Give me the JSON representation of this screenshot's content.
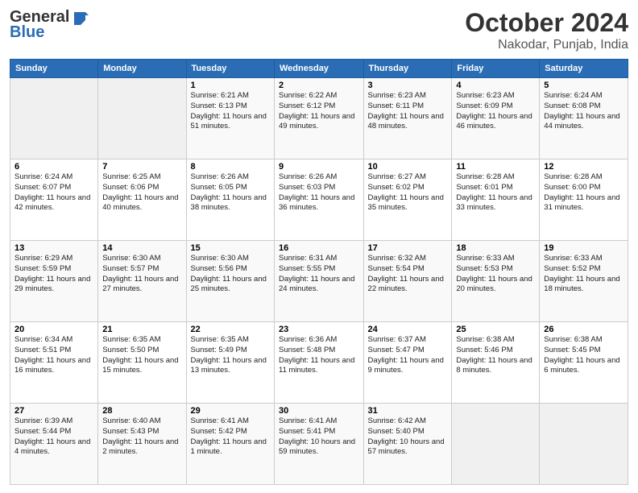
{
  "logo": {
    "general": "General",
    "blue": "Blue"
  },
  "title": "October 2024",
  "location": "Nakodar, Punjab, India",
  "days_of_week": [
    "Sunday",
    "Monday",
    "Tuesday",
    "Wednesday",
    "Thursday",
    "Friday",
    "Saturday"
  ],
  "weeks": [
    [
      {
        "day": "",
        "info": ""
      },
      {
        "day": "",
        "info": ""
      },
      {
        "day": "1",
        "info": "Sunrise: 6:21 AM\nSunset: 6:13 PM\nDaylight: 11 hours and 51 minutes."
      },
      {
        "day": "2",
        "info": "Sunrise: 6:22 AM\nSunset: 6:12 PM\nDaylight: 11 hours and 49 minutes."
      },
      {
        "day": "3",
        "info": "Sunrise: 6:23 AM\nSunset: 6:11 PM\nDaylight: 11 hours and 48 minutes."
      },
      {
        "day": "4",
        "info": "Sunrise: 6:23 AM\nSunset: 6:09 PM\nDaylight: 11 hours and 46 minutes."
      },
      {
        "day": "5",
        "info": "Sunrise: 6:24 AM\nSunset: 6:08 PM\nDaylight: 11 hours and 44 minutes."
      }
    ],
    [
      {
        "day": "6",
        "info": "Sunrise: 6:24 AM\nSunset: 6:07 PM\nDaylight: 11 hours and 42 minutes."
      },
      {
        "day": "7",
        "info": "Sunrise: 6:25 AM\nSunset: 6:06 PM\nDaylight: 11 hours and 40 minutes."
      },
      {
        "day": "8",
        "info": "Sunrise: 6:26 AM\nSunset: 6:05 PM\nDaylight: 11 hours and 38 minutes."
      },
      {
        "day": "9",
        "info": "Sunrise: 6:26 AM\nSunset: 6:03 PM\nDaylight: 11 hours and 36 minutes."
      },
      {
        "day": "10",
        "info": "Sunrise: 6:27 AM\nSunset: 6:02 PM\nDaylight: 11 hours and 35 minutes."
      },
      {
        "day": "11",
        "info": "Sunrise: 6:28 AM\nSunset: 6:01 PM\nDaylight: 11 hours and 33 minutes."
      },
      {
        "day": "12",
        "info": "Sunrise: 6:28 AM\nSunset: 6:00 PM\nDaylight: 11 hours and 31 minutes."
      }
    ],
    [
      {
        "day": "13",
        "info": "Sunrise: 6:29 AM\nSunset: 5:59 PM\nDaylight: 11 hours and 29 minutes."
      },
      {
        "day": "14",
        "info": "Sunrise: 6:30 AM\nSunset: 5:57 PM\nDaylight: 11 hours and 27 minutes."
      },
      {
        "day": "15",
        "info": "Sunrise: 6:30 AM\nSunset: 5:56 PM\nDaylight: 11 hours and 25 minutes."
      },
      {
        "day": "16",
        "info": "Sunrise: 6:31 AM\nSunset: 5:55 PM\nDaylight: 11 hours and 24 minutes."
      },
      {
        "day": "17",
        "info": "Sunrise: 6:32 AM\nSunset: 5:54 PM\nDaylight: 11 hours and 22 minutes."
      },
      {
        "day": "18",
        "info": "Sunrise: 6:33 AM\nSunset: 5:53 PM\nDaylight: 11 hours and 20 minutes."
      },
      {
        "day": "19",
        "info": "Sunrise: 6:33 AM\nSunset: 5:52 PM\nDaylight: 11 hours and 18 minutes."
      }
    ],
    [
      {
        "day": "20",
        "info": "Sunrise: 6:34 AM\nSunset: 5:51 PM\nDaylight: 11 hours and 16 minutes."
      },
      {
        "day": "21",
        "info": "Sunrise: 6:35 AM\nSunset: 5:50 PM\nDaylight: 11 hours and 15 minutes."
      },
      {
        "day": "22",
        "info": "Sunrise: 6:35 AM\nSunset: 5:49 PM\nDaylight: 11 hours and 13 minutes."
      },
      {
        "day": "23",
        "info": "Sunrise: 6:36 AM\nSunset: 5:48 PM\nDaylight: 11 hours and 11 minutes."
      },
      {
        "day": "24",
        "info": "Sunrise: 6:37 AM\nSunset: 5:47 PM\nDaylight: 11 hours and 9 minutes."
      },
      {
        "day": "25",
        "info": "Sunrise: 6:38 AM\nSunset: 5:46 PM\nDaylight: 11 hours and 8 minutes."
      },
      {
        "day": "26",
        "info": "Sunrise: 6:38 AM\nSunset: 5:45 PM\nDaylight: 11 hours and 6 minutes."
      }
    ],
    [
      {
        "day": "27",
        "info": "Sunrise: 6:39 AM\nSunset: 5:44 PM\nDaylight: 11 hours and 4 minutes."
      },
      {
        "day": "28",
        "info": "Sunrise: 6:40 AM\nSunset: 5:43 PM\nDaylight: 11 hours and 2 minutes."
      },
      {
        "day": "29",
        "info": "Sunrise: 6:41 AM\nSunset: 5:42 PM\nDaylight: 11 hours and 1 minute."
      },
      {
        "day": "30",
        "info": "Sunrise: 6:41 AM\nSunset: 5:41 PM\nDaylight: 10 hours and 59 minutes."
      },
      {
        "day": "31",
        "info": "Sunrise: 6:42 AM\nSunset: 5:40 PM\nDaylight: 10 hours and 57 minutes."
      },
      {
        "day": "",
        "info": ""
      },
      {
        "day": "",
        "info": ""
      }
    ]
  ]
}
